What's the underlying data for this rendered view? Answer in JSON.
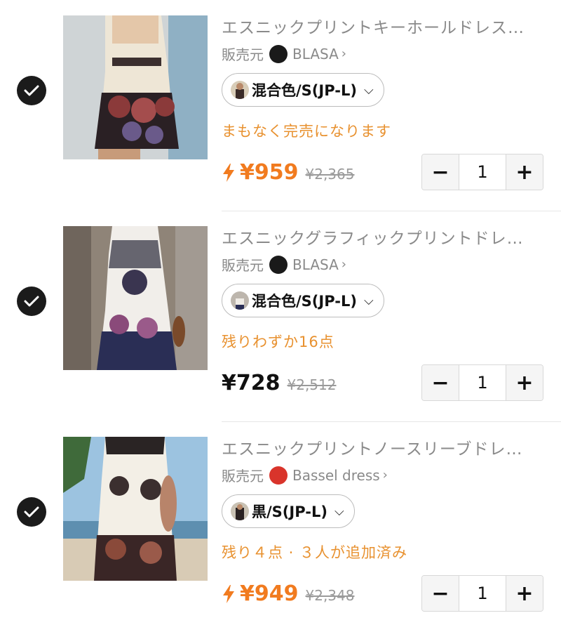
{
  "items": [
    {
      "title": "エスニックプリントキーホールドレス…",
      "seller_prefix": "販売元",
      "seller_name": "BLASA",
      "seller_chevron": "›",
      "variant": "混合色/S(JP-L)",
      "variant_chevron": "⌵",
      "status": "まもなく完売になります",
      "flash_sale": true,
      "price": "¥959",
      "original_price": "¥2,365",
      "quantity": "1",
      "minus": "−",
      "plus": "+",
      "checked": true
    },
    {
      "title": "エスニックグラフィックプリントドレ…",
      "seller_prefix": "販売元",
      "seller_name": "BLASA",
      "seller_chevron": "›",
      "variant": "混合色/S(JP-L)",
      "variant_chevron": "⌵",
      "status": "残りわずか16点",
      "flash_sale": false,
      "price": "¥728",
      "original_price": "¥2,512",
      "quantity": "1",
      "minus": "−",
      "plus": "+",
      "checked": true
    },
    {
      "title": "エスニックプリントノースリーブドレ…",
      "seller_prefix": "販売元",
      "seller_name": "Bassel dress",
      "seller_chevron": "›",
      "variant": "黒/S(JP-L)",
      "variant_chevron": "⌵",
      "status": "残り４点 · ３人が追加済み",
      "flash_sale": true,
      "price": "¥949",
      "original_price": "¥2,348",
      "quantity": "1",
      "minus": "−",
      "plus": "+",
      "checked": true
    }
  ],
  "colors": {
    "accent_orange": "#f17b1f",
    "status_orange": "#e8912f",
    "check_black": "#1b1b1b"
  }
}
